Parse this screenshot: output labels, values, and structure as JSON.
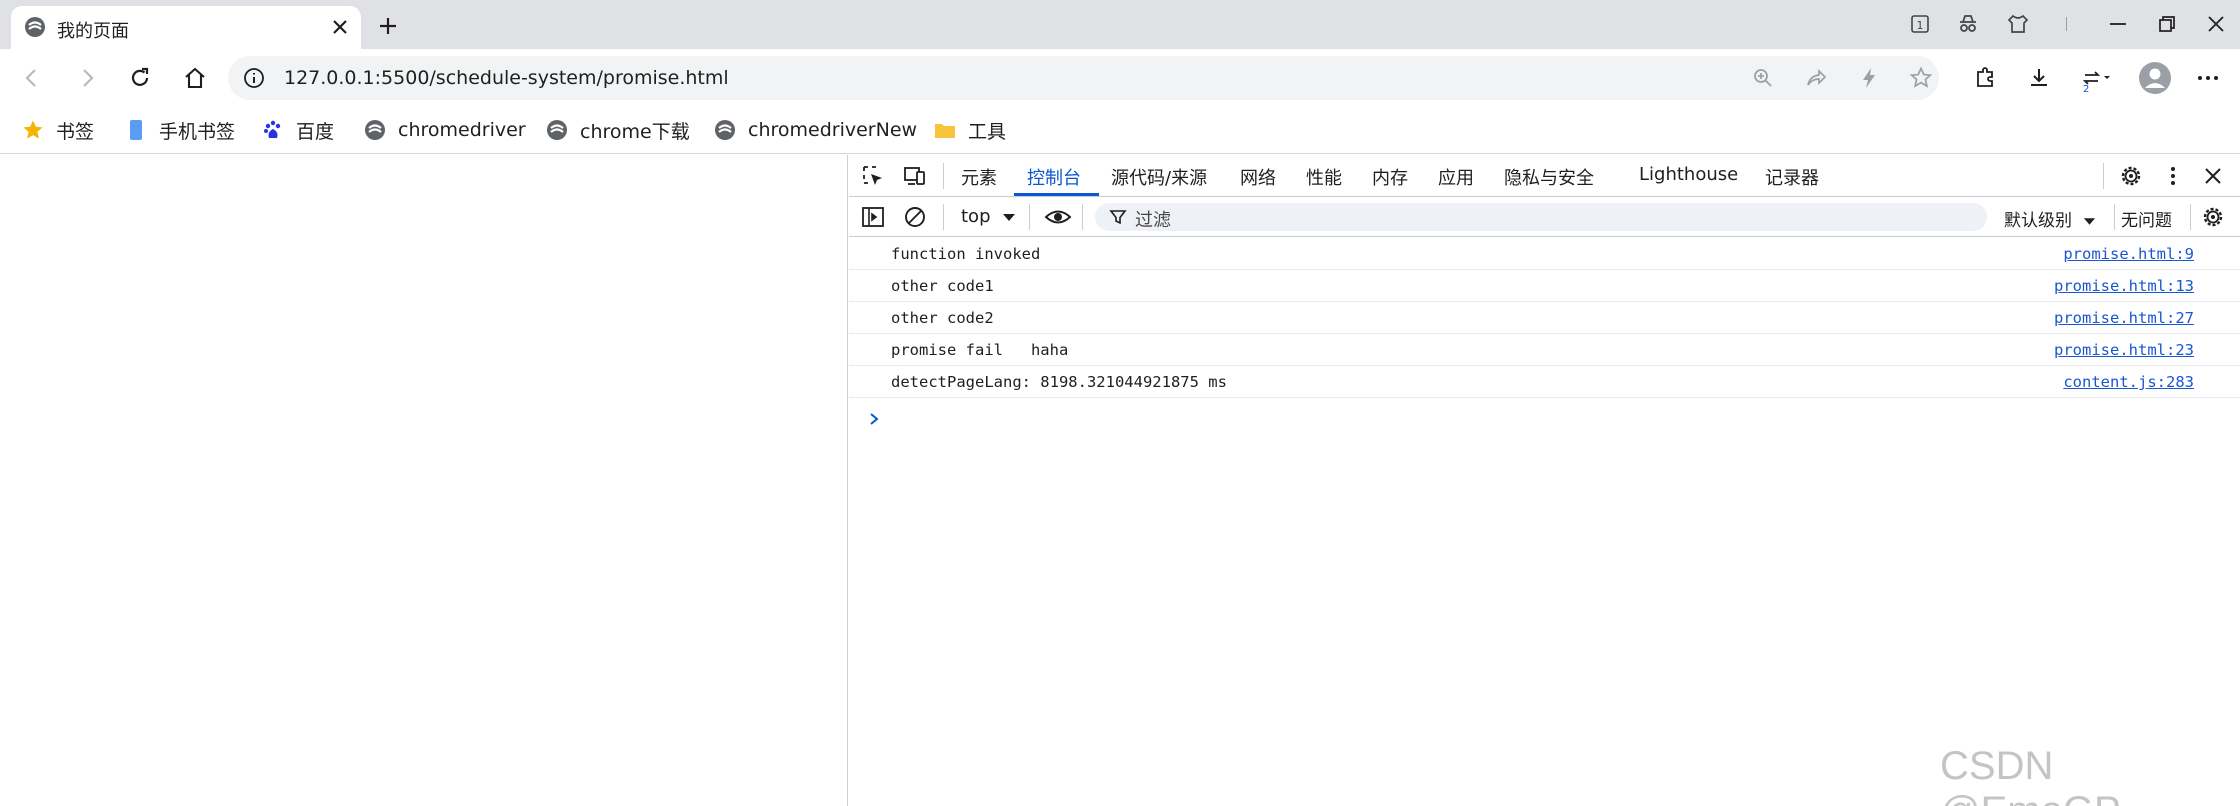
{
  "tab": {
    "title": "我的页面"
  },
  "address": {
    "url": "127.0.0.1:5500/schedule-system/promise.html"
  },
  "bookmarks": [
    {
      "label": "书签"
    },
    {
      "label": "手机书签"
    },
    {
      "label": "百度"
    },
    {
      "label": "chromedriver"
    },
    {
      "label": "chrome下载"
    },
    {
      "label": "chromedriverNew"
    },
    {
      "label": "工具"
    }
  ],
  "devtools": {
    "tabs": [
      "元素",
      "控制台",
      "源代码/来源",
      "网络",
      "性能",
      "内存",
      "应用",
      "隐私与安全",
      "Lighthouse",
      "记录器"
    ],
    "active_tab": "控制台",
    "context": "top",
    "filter_placeholder": "过滤",
    "level": "默认级别",
    "issues": "无问题"
  },
  "console": [
    {
      "message": "function invoked",
      "source": "promise.html:9"
    },
    {
      "message": "other code1",
      "source": "promise.html:13"
    },
    {
      "message": "other code2",
      "source": "promise.html:27"
    },
    {
      "message": "promise fail   haha",
      "source": "promise.html:23"
    },
    {
      "message": "detectPageLang: 8198.321044921875 ms",
      "source": "content.js:283"
    }
  ],
  "extension_badge": "2",
  "tab_count_badge": "1",
  "watermark": "CSDN @EmoGP",
  "colors": {
    "accent": "#0b57d0",
    "link": "#1a57d0",
    "tabstrip": "#dfe1e5",
    "omnibox": "#f1f3f4",
    "bookmark_star": "#f5b400"
  }
}
